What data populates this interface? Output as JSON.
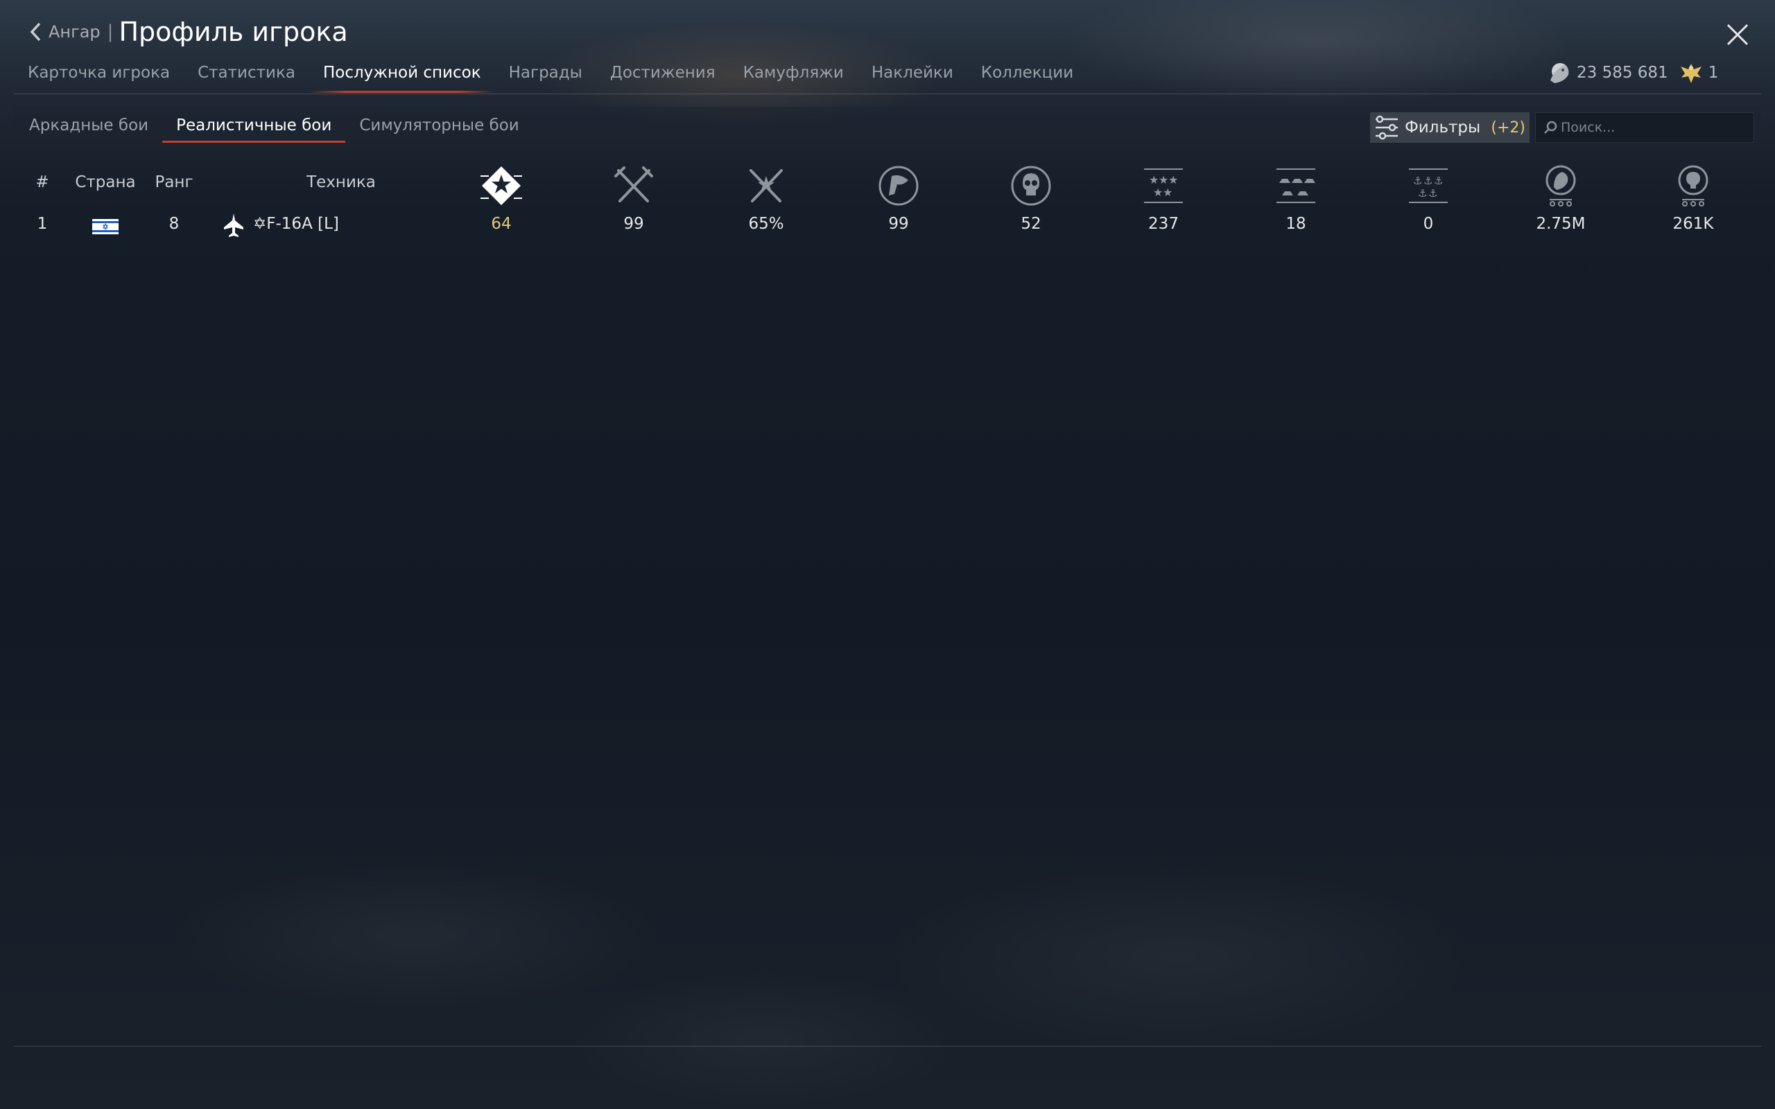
{
  "header": {
    "back_label": "Ангар",
    "separator": "|",
    "title": "Профиль игрока"
  },
  "tabs": [
    {
      "label": "Карточка игрока"
    },
    {
      "label": "Статистика"
    },
    {
      "label": "Послужной список",
      "active": true
    },
    {
      "label": "Награды"
    },
    {
      "label": "Достижения"
    },
    {
      "label": "Камуфляжи"
    },
    {
      "label": "Наклейки"
    },
    {
      "label": "Коллекции"
    }
  ],
  "currency": {
    "lions": "23 585 681",
    "eagles": "1"
  },
  "subtabs": [
    {
      "label": "Аркадные бои"
    },
    {
      "label": "Реалистичные бои",
      "active": true
    },
    {
      "label": "Симуляторные бои"
    }
  ],
  "filters": {
    "label": "Фильтры",
    "count": "(+2)"
  },
  "search": {
    "placeholder": "Поиск..."
  },
  "table": {
    "headers": {
      "num": "#",
      "country": "Страна",
      "rank": "Ранг",
      "vehicle": "Техника"
    },
    "stat_icons": [
      "battles-star-icon",
      "victories-swords-icon",
      "win-rate-icon",
      "respawns-flag-icon",
      "deaths-skull-icon",
      "air-kills-icon",
      "ground-kills-icon",
      "naval-kills-icon",
      "lions-earned-icon",
      "research-points-icon"
    ],
    "rows": [
      {
        "num": "1",
        "country": "Israel",
        "rank": "8",
        "vehicle": "✡F-16A [L]",
        "vehicle_type": "jet-icon",
        "stats": [
          "64",
          "99",
          "65%",
          "99",
          "52",
          "237",
          "18",
          "0",
          "2.75M",
          "261K"
        ]
      }
    ]
  },
  "colors": {
    "accent": "#c2402e",
    "gold": "#e7c77f",
    "text": "#e6e8eb",
    "muted": "#9aa1a9"
  }
}
